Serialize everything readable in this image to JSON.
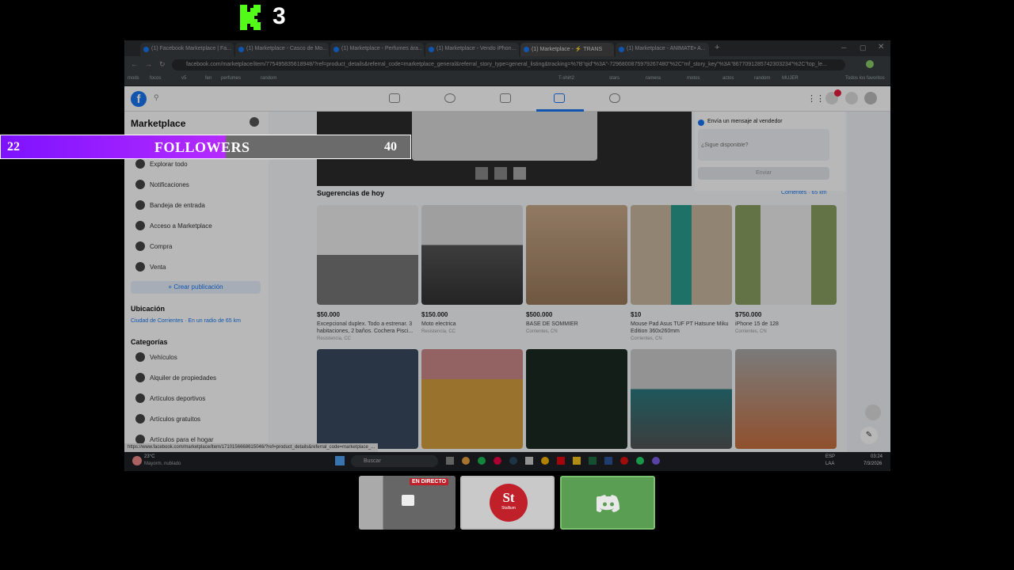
{
  "overlay": {
    "kick_count": "3",
    "followers": {
      "current": "22",
      "label": "FOLLOWERS",
      "goal": "40",
      "progress_fraction": 0.55
    },
    "live_badge": "EN DIRECTO",
    "stallium_text": "St",
    "stallium_sub": "Stallium",
    "brand_colors": {
      "kick": "#53fc18",
      "bar": "#8a1cff",
      "discord": "#5a9e53"
    }
  },
  "browser": {
    "tabs": [
      "(1) Facebook Marketplace | Fa...",
      "(1) Marketplace - Casco de Mo...",
      "(1) Marketplace - Perfumes ára...",
      "(1) Marketplace - Vendo iPhon...",
      "(1) Marketplace - ⚡ TRANS",
      "(1) Marketplace - ANIMATE• A..."
    ],
    "url": "facebook.com/marketplace/item/775495835618948/?ref=product_details&referral_code=marketplace_general&referral_story_type=general_listing&tracking=%7B\"qid\"%3A\"-7296800875979267480\"%2C\"mf_story_key\"%3A\"8677091285742303234\"%2C\"top_le...",
    "bookmarks": [
      "mods",
      "focos",
      "v5",
      "fen",
      "perfumes",
      "random",
      "T-shirt2",
      "stars",
      "ramera",
      "motos",
      "actos",
      "random",
      "MUJER",
      "Todos los favoritos"
    ]
  },
  "facebook": {
    "sidebar": {
      "title": "Marketplace",
      "items": [
        {
          "label": "Explorar todo",
          "icon": "shop-icon"
        },
        {
          "label": "Notificaciones",
          "icon": "bell-icon"
        },
        {
          "label": "Bandeja de entrada",
          "icon": "inbox-icon"
        },
        {
          "label": "Acceso a Marketplace",
          "icon": "user-icon"
        },
        {
          "label": "Compra",
          "icon": "bag-icon"
        },
        {
          "label": "Venta",
          "icon": "tag-icon"
        }
      ],
      "create_button": "+ Crear publicación",
      "location_heading": "Ubicación",
      "location_value": "Ciudad de Corrientes · En un radio de 65 km",
      "categories_heading": "Categorías",
      "categories": [
        "Vehículos",
        "Alquiler de propiedades",
        "Artículos deportivos",
        "Artículos gratuitos",
        "Artículos para el hogar"
      ]
    },
    "seller_panel": {
      "message_label": "Envía un mensaje al vendedor",
      "placeholder": "¿Sigue disponible?",
      "send": "Enviar"
    },
    "suggestions_title": "Sugerencias de hoy",
    "suggestions_location": "Corrientes · 65 km",
    "listings": [
      {
        "price": "$50.000",
        "title": "Excepcional duplex. Todo a estrenar. 3 habitaciones, 2 baños. Cochera Pisci...",
        "location": "Resistencia, CC"
      },
      {
        "price": "$150.000",
        "title": "Moto electrica",
        "location": "Resistencia, CC"
      },
      {
        "price": "$500.000",
        "title": "BASE DE SOMMIER",
        "location": "Corrientes, CN"
      },
      {
        "price": "$10",
        "title": "Mouse Pad Asus TUF PT Hatsune Miku Edition 360x260mm",
        "location": "Corrientes, CN"
      },
      {
        "price": "$750.000",
        "title": "iPhone 15 de 128",
        "location": "Corrientes, CN"
      }
    ],
    "status_url": "https://www.facebook.com/marketplace/item/1710156668615046/?ref=product_details&referral_code=marketplace_..."
  },
  "taskbar": {
    "weather_temp": "23°C",
    "weather_desc": "Mayorm. nublado",
    "search_placeholder": "Buscar",
    "lang": "ESP",
    "lang2": "LAA",
    "time": "03:24",
    "date": "7/3/2026"
  }
}
